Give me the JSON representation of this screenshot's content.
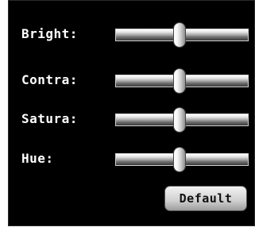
{
  "sliders": [
    {
      "label": "Bright:",
      "value_fraction": 0.48
    },
    {
      "label": "Contra:",
      "value_fraction": 0.48
    },
    {
      "label": "Satura:",
      "value_fraction": 0.48
    },
    {
      "label": "Hue:",
      "value_fraction": 0.48
    }
  ],
  "default_button_label": "Default",
  "colors": {
    "panel_background": "#000000",
    "label_text": "#ffffff"
  }
}
